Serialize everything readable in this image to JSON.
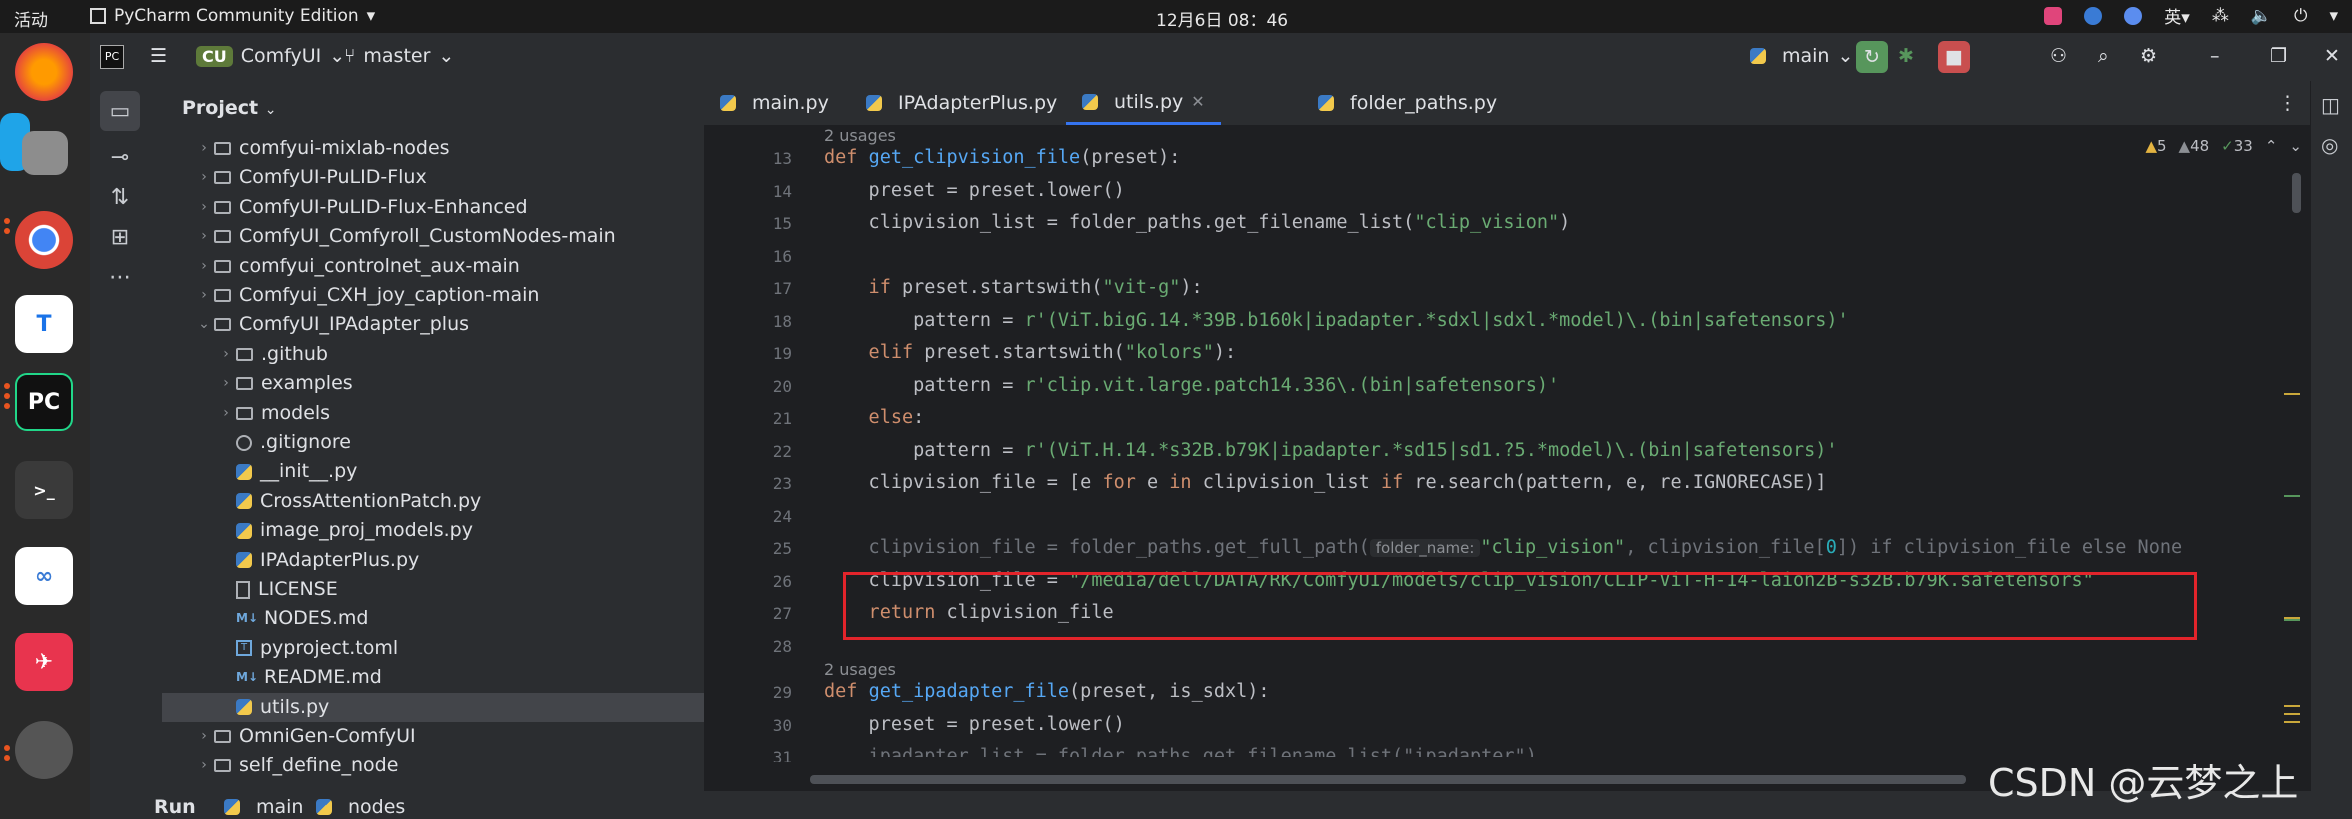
{
  "system_bar": {
    "activities": "活动",
    "app_name": "PyCharm Community Edition",
    "app_arrow": "▾",
    "clock": "12月6日 08：46",
    "input_method": "英",
    "input_arrow": "▾"
  },
  "ide": {
    "project_badge": "CU",
    "project_name": "ComfyUI",
    "branch": "master",
    "run_config": "main",
    "project_panel_title": "Project"
  },
  "tree": [
    {
      "label": "comfyui-mixlab-nodes",
      "type": "folder",
      "indent": 1,
      "arrow": "›"
    },
    {
      "label": "ComfyUI-PuLID-Flux",
      "type": "folder",
      "indent": 1,
      "arrow": "›"
    },
    {
      "label": "ComfyUI-PuLID-Flux-Enhanced",
      "type": "folder",
      "indent": 1,
      "arrow": "›"
    },
    {
      "label": "ComfyUI_Comfyroll_CustomNodes-main",
      "type": "folder",
      "indent": 1,
      "arrow": "›"
    },
    {
      "label": "comfyui_controlnet_aux-main",
      "type": "folder",
      "indent": 1,
      "arrow": "›"
    },
    {
      "label": "Comfyui_CXH_joy_caption-main",
      "type": "folder",
      "indent": 1,
      "arrow": "›"
    },
    {
      "label": "ComfyUI_IPAdapter_plus",
      "type": "folder",
      "indent": 1,
      "arrow": "⌄"
    },
    {
      "label": ".github",
      "type": "folder",
      "indent": 2,
      "arrow": "›"
    },
    {
      "label": "examples",
      "type": "folder",
      "indent": 2,
      "arrow": "›"
    },
    {
      "label": "models",
      "type": "folder",
      "indent": 2,
      "arrow": "›"
    },
    {
      "label": ".gitignore",
      "type": "git",
      "indent": 2,
      "arrow": ""
    },
    {
      "label": "__init__.py",
      "type": "py",
      "indent": 2,
      "arrow": ""
    },
    {
      "label": "CrossAttentionPatch.py",
      "type": "py",
      "indent": 2,
      "arrow": ""
    },
    {
      "label": "image_proj_models.py",
      "type": "py",
      "indent": 2,
      "arrow": ""
    },
    {
      "label": "IPAdapterPlus.py",
      "type": "py",
      "indent": 2,
      "arrow": ""
    },
    {
      "label": "LICENSE",
      "type": "lic",
      "indent": 2,
      "arrow": ""
    },
    {
      "label": "NODES.md",
      "type": "md",
      "indent": 2,
      "arrow": ""
    },
    {
      "label": "pyproject.toml",
      "type": "toml",
      "indent": 2,
      "arrow": ""
    },
    {
      "label": "README.md",
      "type": "md",
      "indent": 2,
      "arrow": ""
    },
    {
      "label": "utils.py",
      "type": "py",
      "indent": 2,
      "arrow": "",
      "selected": true
    },
    {
      "label": "OmniGen-ComfyUI",
      "type": "folder",
      "indent": 1,
      "arrow": "›"
    },
    {
      "label": "self_define_node",
      "type": "folder",
      "indent": 1,
      "arrow": "›"
    }
  ],
  "tabs": [
    {
      "label": "main.py"
    },
    {
      "label": "IPAdapterPlus.py"
    },
    {
      "label": "utils.py",
      "active": true
    },
    {
      "label": "folder_paths.py"
    }
  ],
  "inspections": {
    "warnings": "5",
    "weak": "48",
    "ok": "33"
  },
  "usages": [
    "2 usages",
    "2 usages"
  ],
  "line_numbers": [
    "13",
    "14",
    "15",
    "16",
    "17",
    "18",
    "19",
    "20",
    "21",
    "22",
    "23",
    "24",
    "25",
    "26",
    "27",
    "28",
    "29",
    "30",
    "31"
  ],
  "code": {
    "l13_def": "def ",
    "l13_fn": "get_clipvision_file",
    "l13_rest": "(preset):",
    "l14": "    preset = preset.lower()",
    "l15_a": "    clipvision_list = folder_paths.get_filename_list(",
    "l15_s": "\"clip_vision\"",
    "l15_b": ")",
    "l17_kw": "    if ",
    "l17_a": "preset.startswith(",
    "l17_s": "\"vit-g\"",
    "l17_b": "):",
    "l18_a": "        pattern = ",
    "l18_s": "r'(ViT.bigG.14.*39B.b160k|ipadapter.*sdxl|sdxl.*model)\\.(bin|safetensors)'",
    "l19_kw": "    elif ",
    "l19_a": "preset.startswith(",
    "l19_s": "\"kolors\"",
    "l19_b": "):",
    "l20_a": "        pattern = ",
    "l20_s": "r'clip.vit.large.patch14.336\\.(bin|safetensors)'",
    "l21_kw": "    else",
    "l21_b": ":",
    "l22_a": "        pattern = ",
    "l22_s": "r'(ViT.H.14.*s32B.b79K|ipadapter.*sd15|sd1.?5.*model)\\.(bin|safetensors)'",
    "l23_a": "    clipvision_file = [e ",
    "l23_kw1": "for ",
    "l23_b": "e ",
    "l23_kw2": "in ",
    "l23_c": "clipvision_list ",
    "l23_kw3": "if ",
    "l23_d": "re.search(pattern, e, re.IGNORECASE)]",
    "l25_a": "    clipvision_file = folder_paths.get_full_path(",
    "l25_hint": "folder_name:",
    "l25_s": "\"clip_vision\"",
    "l25_b": ", clipvision_file[",
    "l25_n": "0",
    "l25_c": "]) if clipvision_file else None",
    "l26_a": "    clipvision_file = ",
    "l26_s": "\"/media/dell/DATA/RK/ComfyUI/models/clip_vision/CLIP-ViT-H-14-laion2B-s32B.b79K.safetensors\"",
    "l27_kw": "    return ",
    "l27_a": "clipvision_file",
    "l29_def": "def ",
    "l29_fn": "get_ipadapter_file",
    "l29_rest": "(preset, is_sdxl):",
    "l30": "    preset = preset.lower()",
    "l31": "    ipadapter_list = folder_paths.get_filename_list(\"ipadapter\")"
  },
  "bottom": {
    "run": "Run",
    "main": "main",
    "nodes": "nodes"
  },
  "watermark": "CSDN @云梦之上",
  "colors": {
    "keyword": "#cf8e6d",
    "function": "#56a8f5",
    "string": "#6aab73",
    "highlight_box": "#e3242b"
  }
}
